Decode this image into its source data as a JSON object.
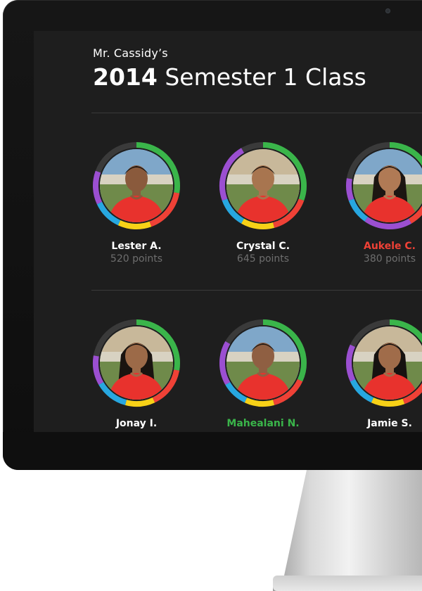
{
  "header": {
    "eyebrow": "Mr. Cassidy’s",
    "title_year": "2014",
    "title_rest": "Semester 1 Class"
  },
  "colors": {
    "red": "#ef4136",
    "green": "#3ab54a",
    "yellow": "#f7d117",
    "blue": "#27a7e0",
    "purple": "#9b4fd1",
    "track": "#3a3a3a"
  },
  "students": [
    {
      "name": "Lester A.",
      "points": "520 points",
      "name_color": "#ffffff"
    },
    {
      "name": "Crystal C.",
      "points": "645 points",
      "name_color": "#ffffff"
    },
    {
      "name": "Aukele C.",
      "points": "380 points",
      "name_color": "#ef4136"
    },
    {
      "name": "Jonay I.",
      "points": "",
      "name_color": "#ffffff"
    },
    {
      "name": "Mahealani N.",
      "points": "",
      "name_color": "#3ab54a"
    },
    {
      "name": "Jamie S.",
      "points": "",
      "name_color": "#ffffff"
    }
  ]
}
